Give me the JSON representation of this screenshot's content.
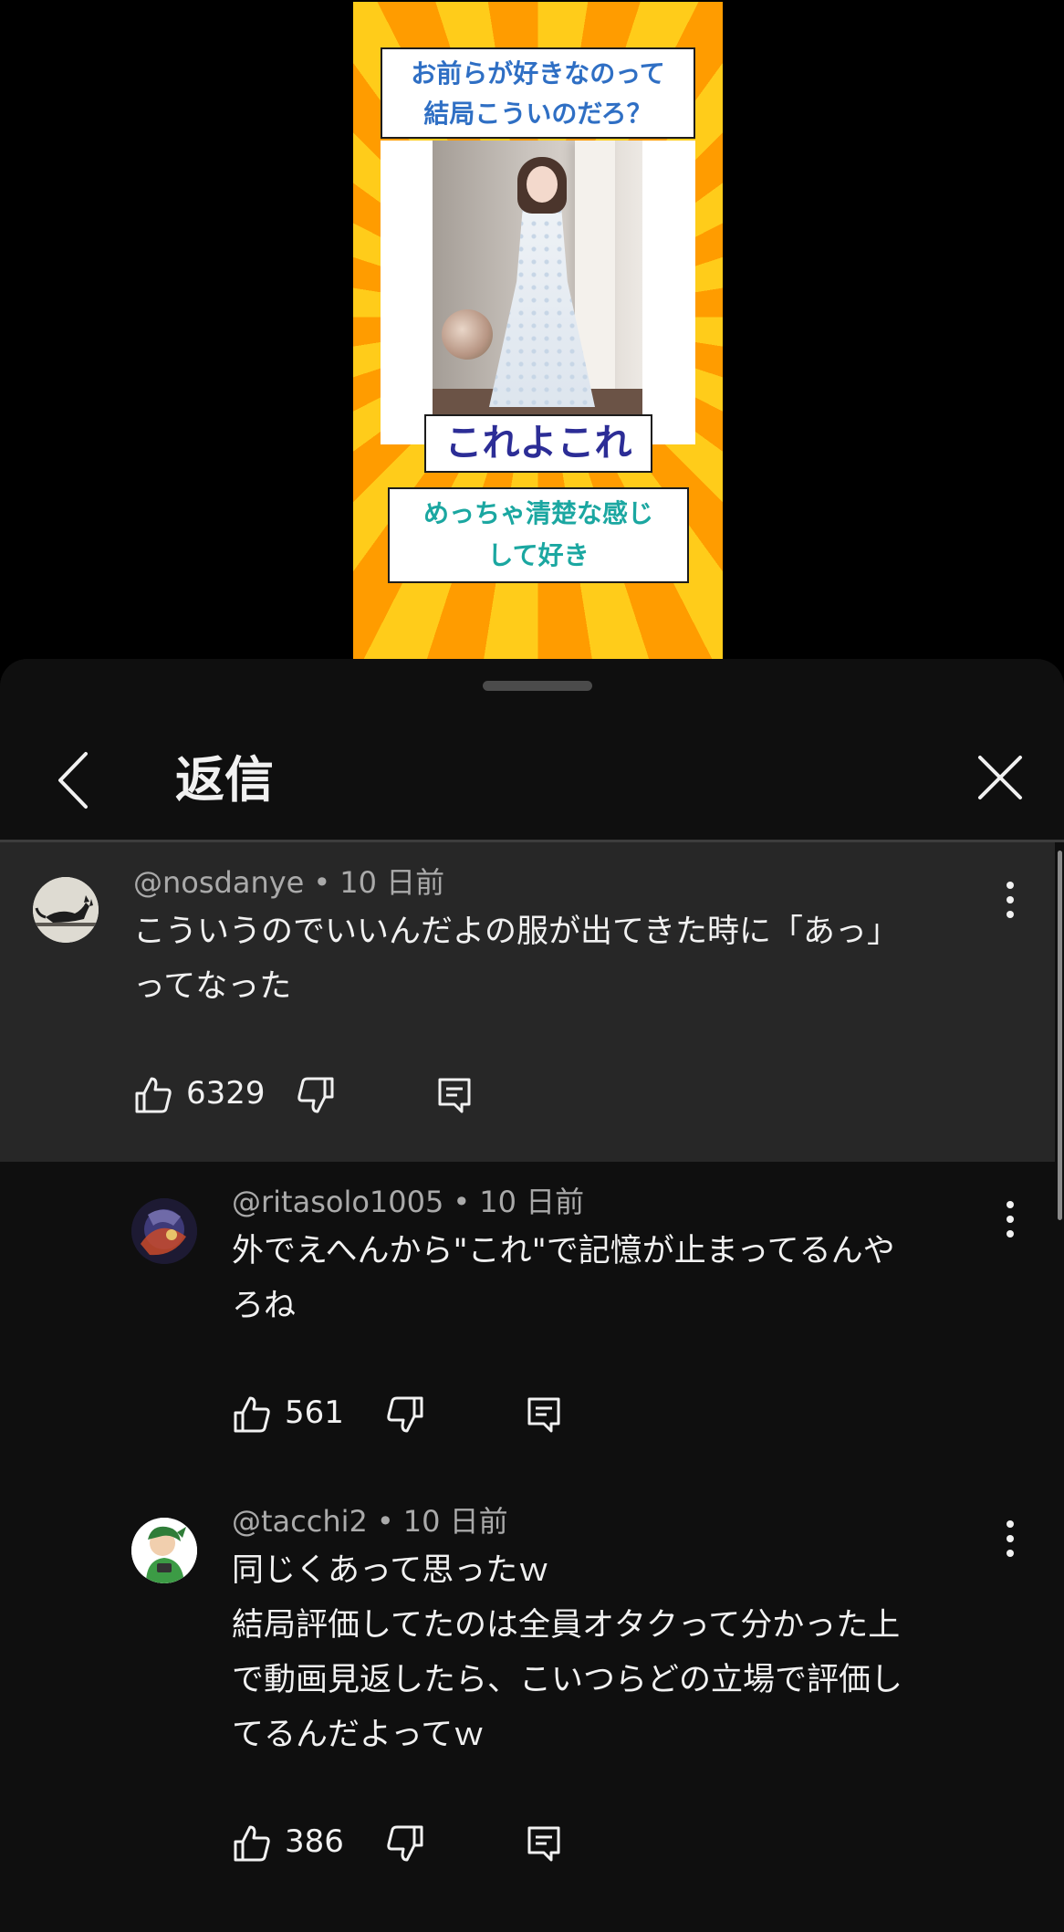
{
  "video": {
    "caption_top": "お前らが好きなのって\n結局こういのだろ？",
    "caption_mid": "これよこれ",
    "caption_bottom": "めっちゃ清楚な感じ\nして好き"
  },
  "header": {
    "title": "返信"
  },
  "icons": {
    "back": "chevron-left-icon",
    "close": "close-icon",
    "more": "more-vert-icon",
    "like": "thumb-up-icon",
    "dislike": "thumb-down-icon",
    "reply": "reply-icon"
  },
  "comments": [
    {
      "author": "@nosdanye",
      "time": "10 日前",
      "text": "こういうのでいいんだよの服が出てきた時に「あっ」\nってなった",
      "likes": "6329"
    },
    {
      "author": "@ritasolo1005",
      "time": "10 日前",
      "text": "外でえへんから\"これ\"で記憶が止まってるんや\nろね",
      "likes": "561"
    },
    {
      "author": "@tacchi2",
      "time": "10 日前",
      "text": "同じくあって思ったｗ\n結局評価してたのは全員オタクって分かった上\nで動画見返したら、こいつらどの立場で評価し\nてるんだよってｗ",
      "likes": "386"
    }
  ],
  "colors": {
    "sheet_bg": "#0f0f0f",
    "highlight_bg": "#272727",
    "text": "#f1f1f1",
    "meta": "#aaaaaa"
  }
}
